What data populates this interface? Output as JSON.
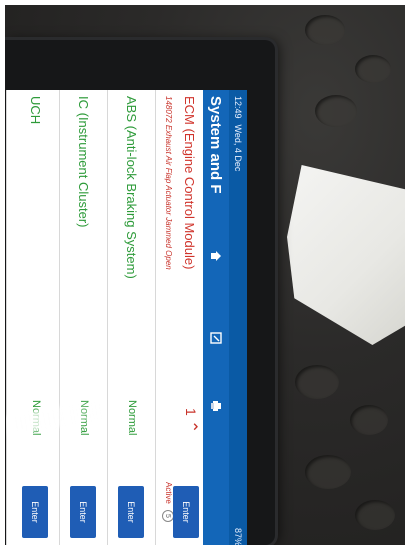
{
  "status_bar": {
    "time": "12:49",
    "date": "Wed, 4 Dec",
    "battery": "87%"
  },
  "app_bar": {
    "title": "System and F",
    "icons": [
      "home-icon",
      "edit-icon",
      "print-icon"
    ]
  },
  "systems": [
    {
      "name": "ECM (Engine Control Module)",
      "fault": "148072 Exhaust Air Flap Actuator Jammed Open",
      "state": "Active",
      "count": "1",
      "badge": "5",
      "button": "Enter"
    },
    {
      "name": "ABS (Anti-lock Braking System)",
      "status": "Normal",
      "button": "Enter"
    },
    {
      "name": "IC (Instrument Cluster)",
      "status": "Normal",
      "button": "Enter"
    },
    {
      "name": "UCH",
      "status": "Normal",
      "button": "Enter"
    }
  ],
  "colors": {
    "app_bar": "#1366b8",
    "status_normal": "#2e9b3a",
    "fault_red": "#c8332b",
    "enter_button": "#1f5db5"
  }
}
